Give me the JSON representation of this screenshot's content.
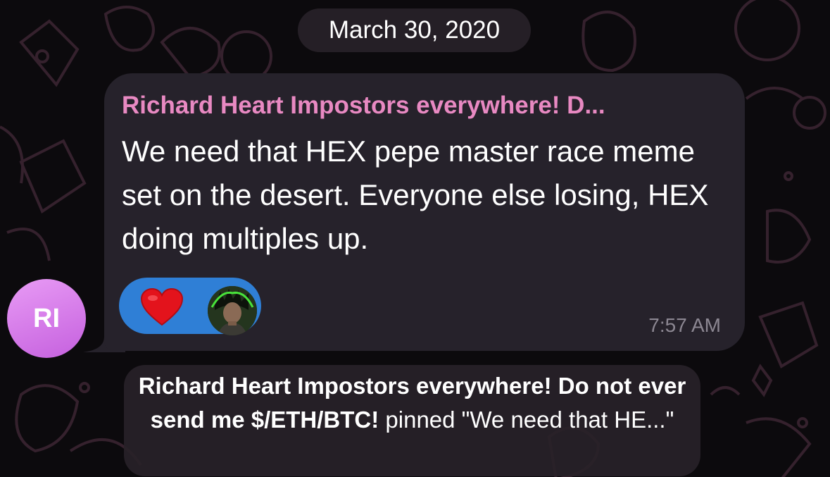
{
  "date_header": "March 30, 2020",
  "message": {
    "sender": "Richard Heart Impostors everywhere! D...",
    "text": "We need that HEX pepe master race meme set on the desert. Everyone else losing, HEX doing multiples up.",
    "time": "7:57 AM",
    "reactions": [
      {
        "emoji": "heart",
        "reactor": "avatar-icon"
      }
    ]
  },
  "sender_avatar": {
    "initials": "RI"
  },
  "service_message": {
    "actor": "Richard Heart Impostors everywhere! Do not ever send me $/ETH/BTC!",
    "action": " pinned \"We need that HE...\""
  },
  "colors": {
    "background": "#0c0a0d",
    "bubble": "#26222b",
    "sender_name": "#e889c2",
    "reaction_pill": "#2f7fd6",
    "avatar": "#d07ae8"
  }
}
